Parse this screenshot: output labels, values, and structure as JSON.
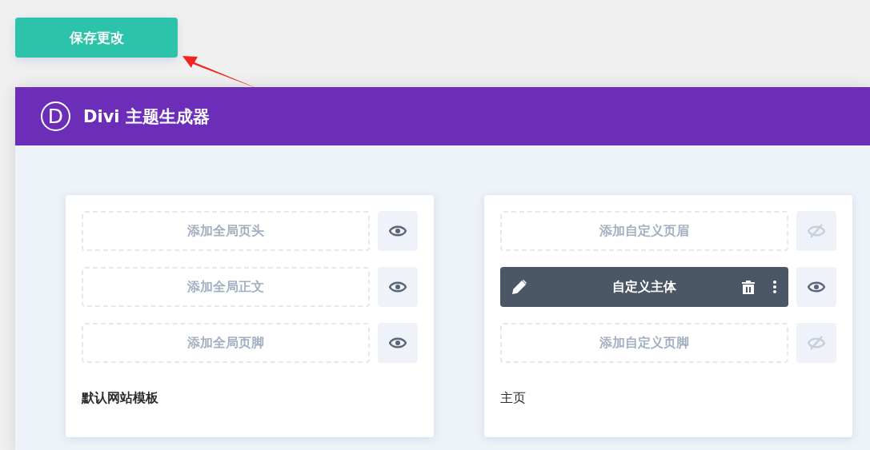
{
  "save_button": {
    "label": "保存更改"
  },
  "annotation": {
    "kind": "arrow"
  },
  "panel": {
    "logo": "D",
    "title": "Divi 主题生成器"
  },
  "templates": [
    {
      "name": "默认网站模板",
      "is_default": true,
      "slots": [
        {
          "kind": "empty",
          "label": "添加全局页头",
          "visible": true
        },
        {
          "kind": "empty",
          "label": "添加全局正文",
          "visible": true
        },
        {
          "kind": "empty",
          "label": "添加全局页脚",
          "visible": true
        }
      ]
    },
    {
      "name": "主页",
      "is_default": false,
      "slots": [
        {
          "kind": "empty",
          "label": "添加自定义页眉",
          "visible": false
        },
        {
          "kind": "filled",
          "label": "自定义主体",
          "visible": true
        },
        {
          "kind": "empty",
          "label": "添加自定义页脚",
          "visible": false
        }
      ]
    }
  ]
}
